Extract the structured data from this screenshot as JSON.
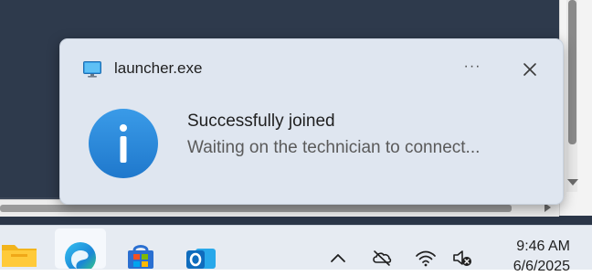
{
  "toast": {
    "app_name": "launcher.exe",
    "more_label": "···",
    "title": "Successfully joined",
    "body": "Waiting on the technician to connect...",
    "accent_color": "#2b88d8",
    "background_color": "#dfe6f0"
  },
  "taskbar": {
    "apps": [
      {
        "name": "File Explorer",
        "icon": "folder-icon"
      },
      {
        "name": "Microsoft Edge",
        "icon": "edge-icon"
      },
      {
        "name": "Microsoft Store",
        "icon": "store-icon"
      },
      {
        "name": "Outlook",
        "icon": "outlook-icon"
      }
    ],
    "tray": {
      "icons": [
        "chevron-up-icon",
        "onedrive-offline-icon",
        "wifi-icon",
        "speaker-muted-icon"
      ],
      "time": "9:46 AM",
      "date": "6/6/2025"
    }
  }
}
